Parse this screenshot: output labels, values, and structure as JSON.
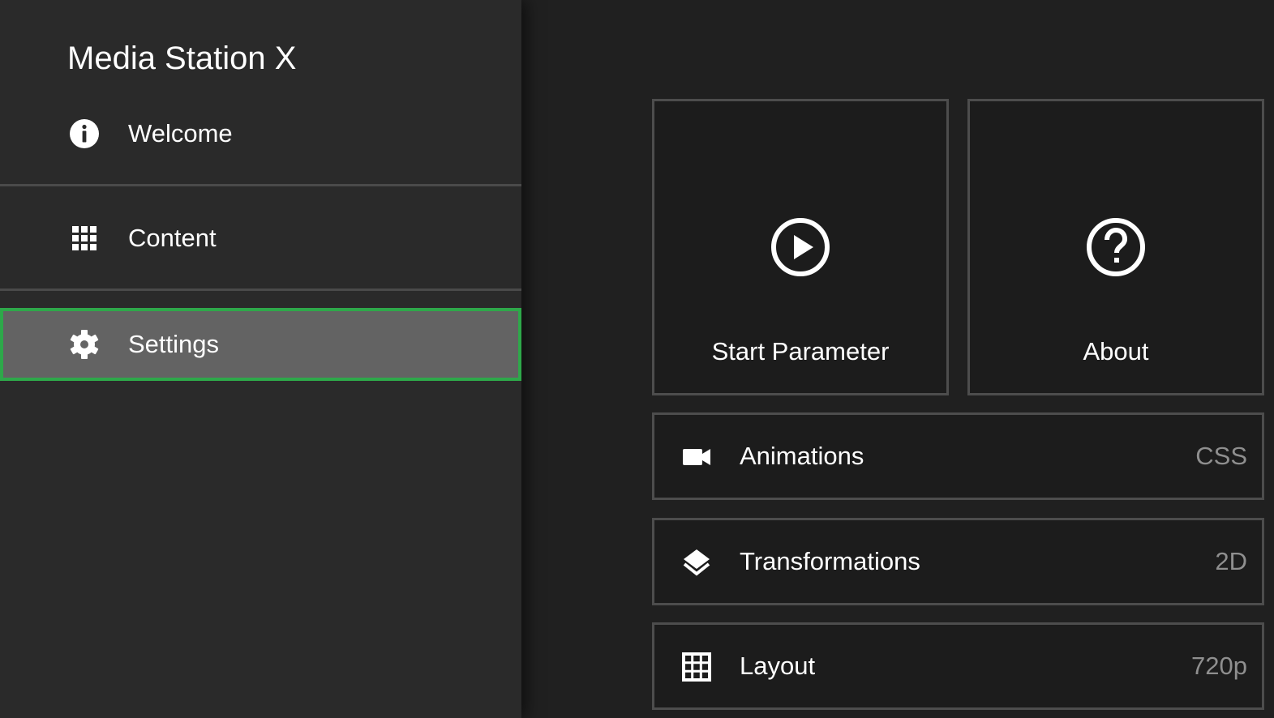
{
  "app": {
    "title": "Media Station X"
  },
  "sidebar": {
    "items": [
      {
        "label": "Welcome",
        "icon": "info-icon"
      },
      {
        "label": "Content",
        "icon": "grid-icon"
      },
      {
        "label": "Settings",
        "icon": "gear-icon",
        "selected": true
      }
    ]
  },
  "main": {
    "tiles": [
      {
        "label": "Start Parameter",
        "icon": "play-circle-icon"
      },
      {
        "label": "About",
        "icon": "help-circle-icon"
      }
    ],
    "rows": [
      {
        "label": "Animations",
        "value": "CSS",
        "icon": "video-camera-icon"
      },
      {
        "label": "Transformations",
        "value": "2D",
        "icon": "layers-icon"
      },
      {
        "label": "Layout",
        "value": "720p",
        "icon": "table-grid-icon"
      }
    ]
  },
  "colors": {
    "sidebar_background": "#2a2a2a",
    "main_background": "#202020",
    "selected_background": "#636363",
    "focus_border": "#2ea84a",
    "tile_border": "#4d4d4d",
    "secondary_text": "#8f8f8f"
  }
}
